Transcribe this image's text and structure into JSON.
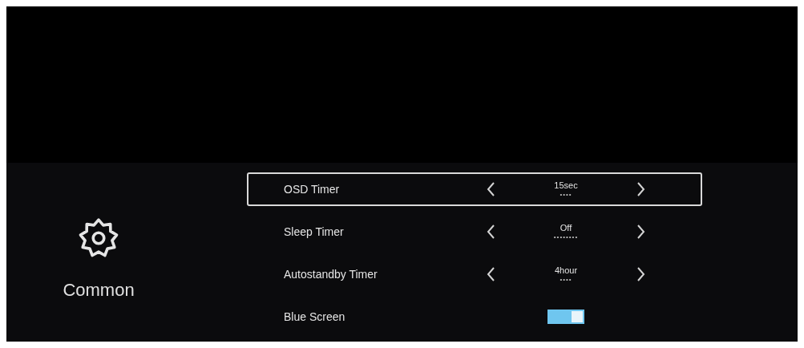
{
  "category": {
    "label": "Common"
  },
  "settings": [
    {
      "kind": "choice",
      "label": "OSD Timer",
      "value": "15sec",
      "indicator": "••••",
      "selected": true
    },
    {
      "kind": "choice",
      "label": "Sleep Timer",
      "value": "Off",
      "indicator": "••••••••",
      "selected": false
    },
    {
      "kind": "choice",
      "label": "Autostandby Timer",
      "value": "4hour",
      "indicator": "••••",
      "selected": false
    },
    {
      "kind": "toggle",
      "label": "Blue Screen",
      "on": true,
      "selected": false
    }
  ]
}
